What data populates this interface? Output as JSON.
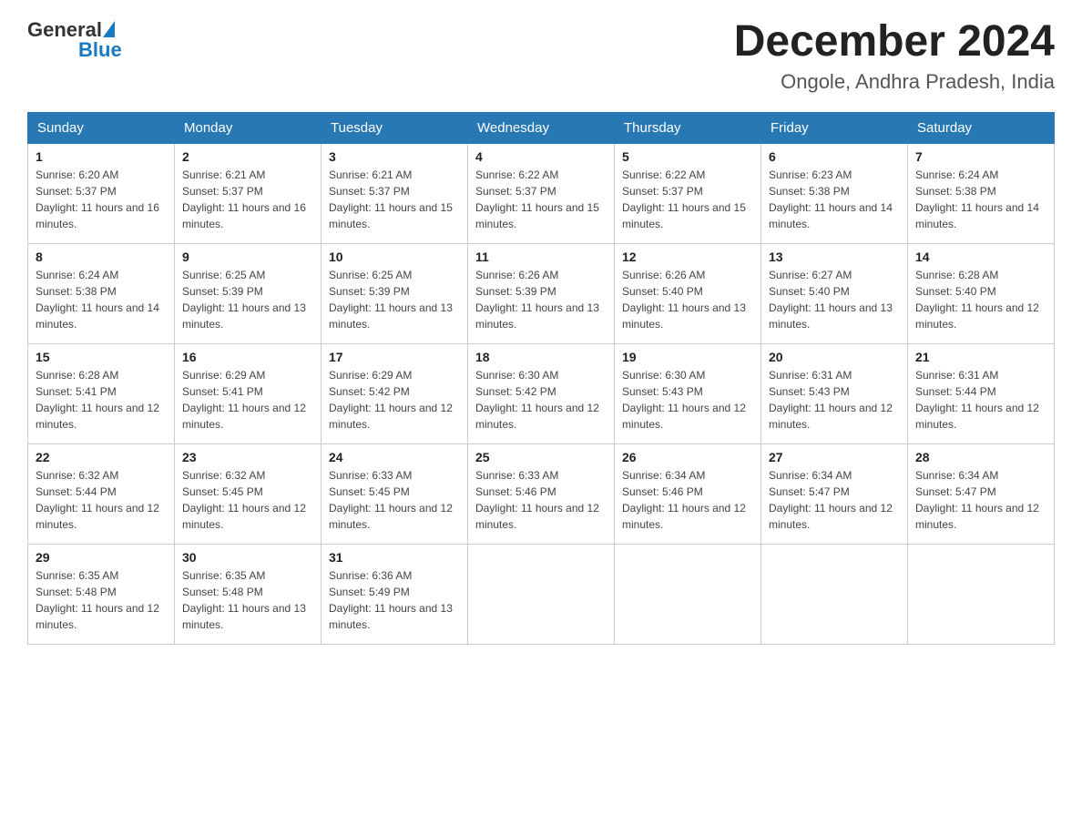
{
  "header": {
    "logo_general": "General",
    "logo_blue": "Blue",
    "month_title": "December 2024",
    "location": "Ongole, Andhra Pradesh, India"
  },
  "days_of_week": [
    "Sunday",
    "Monday",
    "Tuesday",
    "Wednesday",
    "Thursday",
    "Friday",
    "Saturday"
  ],
  "weeks": [
    [
      {
        "day": "1",
        "sunrise": "6:20 AM",
        "sunset": "5:37 PM",
        "daylight": "11 hours and 16 minutes."
      },
      {
        "day": "2",
        "sunrise": "6:21 AM",
        "sunset": "5:37 PM",
        "daylight": "11 hours and 16 minutes."
      },
      {
        "day": "3",
        "sunrise": "6:21 AM",
        "sunset": "5:37 PM",
        "daylight": "11 hours and 15 minutes."
      },
      {
        "day": "4",
        "sunrise": "6:22 AM",
        "sunset": "5:37 PM",
        "daylight": "11 hours and 15 minutes."
      },
      {
        "day": "5",
        "sunrise": "6:22 AM",
        "sunset": "5:37 PM",
        "daylight": "11 hours and 15 minutes."
      },
      {
        "day": "6",
        "sunrise": "6:23 AM",
        "sunset": "5:38 PM",
        "daylight": "11 hours and 14 minutes."
      },
      {
        "day": "7",
        "sunrise": "6:24 AM",
        "sunset": "5:38 PM",
        "daylight": "11 hours and 14 minutes."
      }
    ],
    [
      {
        "day": "8",
        "sunrise": "6:24 AM",
        "sunset": "5:38 PM",
        "daylight": "11 hours and 14 minutes."
      },
      {
        "day": "9",
        "sunrise": "6:25 AM",
        "sunset": "5:39 PM",
        "daylight": "11 hours and 13 minutes."
      },
      {
        "day": "10",
        "sunrise": "6:25 AM",
        "sunset": "5:39 PM",
        "daylight": "11 hours and 13 minutes."
      },
      {
        "day": "11",
        "sunrise": "6:26 AM",
        "sunset": "5:39 PM",
        "daylight": "11 hours and 13 minutes."
      },
      {
        "day": "12",
        "sunrise": "6:26 AM",
        "sunset": "5:40 PM",
        "daylight": "11 hours and 13 minutes."
      },
      {
        "day": "13",
        "sunrise": "6:27 AM",
        "sunset": "5:40 PM",
        "daylight": "11 hours and 13 minutes."
      },
      {
        "day": "14",
        "sunrise": "6:28 AM",
        "sunset": "5:40 PM",
        "daylight": "11 hours and 12 minutes."
      }
    ],
    [
      {
        "day": "15",
        "sunrise": "6:28 AM",
        "sunset": "5:41 PM",
        "daylight": "11 hours and 12 minutes."
      },
      {
        "day": "16",
        "sunrise": "6:29 AM",
        "sunset": "5:41 PM",
        "daylight": "11 hours and 12 minutes."
      },
      {
        "day": "17",
        "sunrise": "6:29 AM",
        "sunset": "5:42 PM",
        "daylight": "11 hours and 12 minutes."
      },
      {
        "day": "18",
        "sunrise": "6:30 AM",
        "sunset": "5:42 PM",
        "daylight": "11 hours and 12 minutes."
      },
      {
        "day": "19",
        "sunrise": "6:30 AM",
        "sunset": "5:43 PM",
        "daylight": "11 hours and 12 minutes."
      },
      {
        "day": "20",
        "sunrise": "6:31 AM",
        "sunset": "5:43 PM",
        "daylight": "11 hours and 12 minutes."
      },
      {
        "day": "21",
        "sunrise": "6:31 AM",
        "sunset": "5:44 PM",
        "daylight": "11 hours and 12 minutes."
      }
    ],
    [
      {
        "day": "22",
        "sunrise": "6:32 AM",
        "sunset": "5:44 PM",
        "daylight": "11 hours and 12 minutes."
      },
      {
        "day": "23",
        "sunrise": "6:32 AM",
        "sunset": "5:45 PM",
        "daylight": "11 hours and 12 minutes."
      },
      {
        "day": "24",
        "sunrise": "6:33 AM",
        "sunset": "5:45 PM",
        "daylight": "11 hours and 12 minutes."
      },
      {
        "day": "25",
        "sunrise": "6:33 AM",
        "sunset": "5:46 PM",
        "daylight": "11 hours and 12 minutes."
      },
      {
        "day": "26",
        "sunrise": "6:34 AM",
        "sunset": "5:46 PM",
        "daylight": "11 hours and 12 minutes."
      },
      {
        "day": "27",
        "sunrise": "6:34 AM",
        "sunset": "5:47 PM",
        "daylight": "11 hours and 12 minutes."
      },
      {
        "day": "28",
        "sunrise": "6:34 AM",
        "sunset": "5:47 PM",
        "daylight": "11 hours and 12 minutes."
      }
    ],
    [
      {
        "day": "29",
        "sunrise": "6:35 AM",
        "sunset": "5:48 PM",
        "daylight": "11 hours and 12 minutes."
      },
      {
        "day": "30",
        "sunrise": "6:35 AM",
        "sunset": "5:48 PM",
        "daylight": "11 hours and 13 minutes."
      },
      {
        "day": "31",
        "sunrise": "6:36 AM",
        "sunset": "5:49 PM",
        "daylight": "11 hours and 13 minutes."
      },
      null,
      null,
      null,
      null
    ]
  ]
}
